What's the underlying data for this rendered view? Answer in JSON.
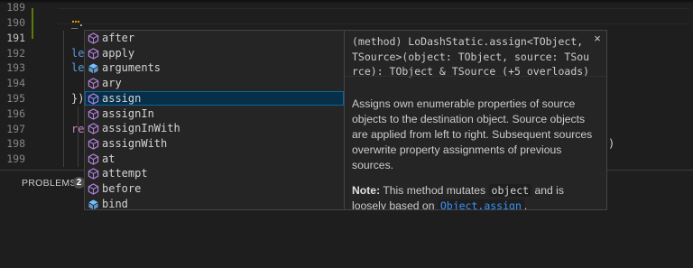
{
  "colors": {
    "editor_bg": "#1e1e1e",
    "widget_bg": "#252526",
    "widget_border": "#454545",
    "selected_bg": "#062f4a",
    "method_icon": "#b180d7",
    "variable_icon": "#75beff",
    "link": "#3794ff",
    "gutter_modified": "#587c0c"
  },
  "editor": {
    "line_numbers": [
      "189",
      "190",
      "191",
      "192",
      "193",
      "194",
      "195",
      "196",
      "197",
      "198",
      "199"
    ],
    "active_line": "191",
    "visible_code": {
      "l191": "_.",
      "l192": "le",
      "l193": "le",
      "l195": "})",
      "l197": "re",
      "l198": ")"
    }
  },
  "suggest": {
    "items": [
      {
        "label": "after",
        "icon": "method-cube-icon"
      },
      {
        "label": "apply",
        "icon": "method-cube-icon"
      },
      {
        "label": "arguments",
        "icon": "variable-icon"
      },
      {
        "label": "ary",
        "icon": "method-cube-icon"
      },
      {
        "label": "assign",
        "icon": "method-cube-icon",
        "selected": true
      },
      {
        "label": "assignIn",
        "icon": "method-cube-icon"
      },
      {
        "label": "assignInWith",
        "icon": "method-cube-icon"
      },
      {
        "label": "assignWith",
        "icon": "method-cube-icon"
      },
      {
        "label": "at",
        "icon": "method-cube-icon"
      },
      {
        "label": "attempt",
        "icon": "method-cube-icon"
      },
      {
        "label": "before",
        "icon": "method-cube-icon"
      },
      {
        "label": "bind",
        "icon": "variable-icon"
      }
    ]
  },
  "details": {
    "signature": "(method) LoDashStatic.assign<TObject,\nTSource>(object: TObject, source: TSou\nrce): TObject & TSource (+5 overloads)",
    "close_symbol": "×",
    "documentation": "Assigns own enumerable properties of source\nobjects to the destination object. Source objects\nare applied from left to right. Subsequent sources\noverwrite property assignments of previous\nsources.",
    "note_label": "Note:",
    "note_text_1": " This method mutates ",
    "note_code": "object",
    "note_text_2": " and is",
    "note_text_3": "loosely based on ",
    "note_link": "Object.assign",
    "note_text_4": "."
  },
  "panel": {
    "tab_label": "PROBLEMS",
    "badge_count": "2"
  }
}
